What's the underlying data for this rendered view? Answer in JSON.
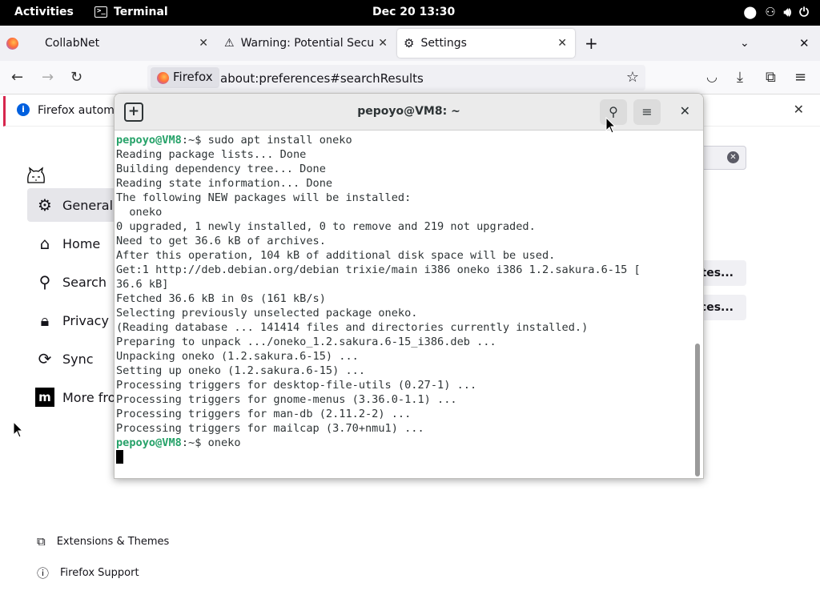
{
  "topbar": {
    "activities": "Activities",
    "app_name": "Terminal",
    "clock": "Dec 20  13:30"
  },
  "firefox": {
    "tabs": [
      {
        "label": "CollabNet"
      },
      {
        "label": "Warning: Potential Securi"
      },
      {
        "label": "Settings"
      }
    ],
    "identity_label": "Firefox",
    "url": "about:preferences#searchResults",
    "notification_text": "Firefox automa",
    "sidebar": [
      {
        "label": "General"
      },
      {
        "label": "Home"
      },
      {
        "label": "Search"
      },
      {
        "label": "Privacy &"
      },
      {
        "label": "Sync"
      },
      {
        "label": "More fro"
      }
    ],
    "footer": {
      "extensions": "Extensions & Themes",
      "support": "Firefox Support"
    },
    "partial_buttons": [
      "tes...",
      "ces..."
    ]
  },
  "terminal": {
    "title": "pepoyo@VM8: ~",
    "lines": [
      {
        "user": "pepoyo@VM8",
        "text": ":~$ sudo apt install oneko"
      },
      {
        "text": "Reading package lists... Done"
      },
      {
        "text": "Building dependency tree... Done"
      },
      {
        "text": "Reading state information... Done"
      },
      {
        "text": "The following NEW packages will be installed:"
      },
      {
        "text": "  oneko"
      },
      {
        "text": "0 upgraded, 1 newly installed, 0 to remove and 219 not upgraded."
      },
      {
        "text": "Need to get 36.6 kB of archives."
      },
      {
        "text": "After this operation, 104 kB of additional disk space will be used."
      },
      {
        "text": "Get:1 http://deb.debian.org/debian trixie/main i386 oneko i386 1.2.sakura.6-15 ["
      },
      {
        "text": "36.6 kB]"
      },
      {
        "text": "Fetched 36.6 kB in 0s (161 kB/s)"
      },
      {
        "text": "Selecting previously unselected package oneko."
      },
      {
        "text": "(Reading database ... 141414 files and directories currently installed.)"
      },
      {
        "text": "Preparing to unpack .../oneko_1.2.sakura.6-15_i386.deb ..."
      },
      {
        "text": "Unpacking oneko (1.2.sakura.6-15) ..."
      },
      {
        "text": "Setting up oneko (1.2.sakura.6-15) ..."
      },
      {
        "text": "Processing triggers for desktop-file-utils (0.27-1) ..."
      },
      {
        "text": "Processing triggers for gnome-menus (3.36.0-1.1) ..."
      },
      {
        "text": "Processing triggers for man-db (2.11.2-2) ..."
      },
      {
        "text": "Processing triggers for mailcap (3.70+nmu1) ..."
      },
      {
        "user": "pepoyo@VM8",
        "text": ":~$ oneko"
      }
    ]
  },
  "colors": {
    "prompt_user": "#26a269",
    "topbar_bg": "#000000",
    "notification_accent": "#d7264d"
  },
  "icons": [
    "terminal-icon",
    "location-icon",
    "accessibility-icon",
    "volume-icon",
    "power-icon",
    "firefox-icon",
    "warning-icon",
    "gear-icon",
    "new-tab-icon",
    "tab-list-icon",
    "close-icon",
    "back-icon",
    "forward-icon",
    "reload-icon",
    "bookmark-star-icon",
    "pocket-icon",
    "download-icon",
    "extensions-icon",
    "menu-icon",
    "info-icon",
    "home-icon",
    "search-icon",
    "lock-icon",
    "sync-icon",
    "mozilla-icon",
    "puzzle-icon",
    "help-icon",
    "oneko-cat-icon"
  ]
}
